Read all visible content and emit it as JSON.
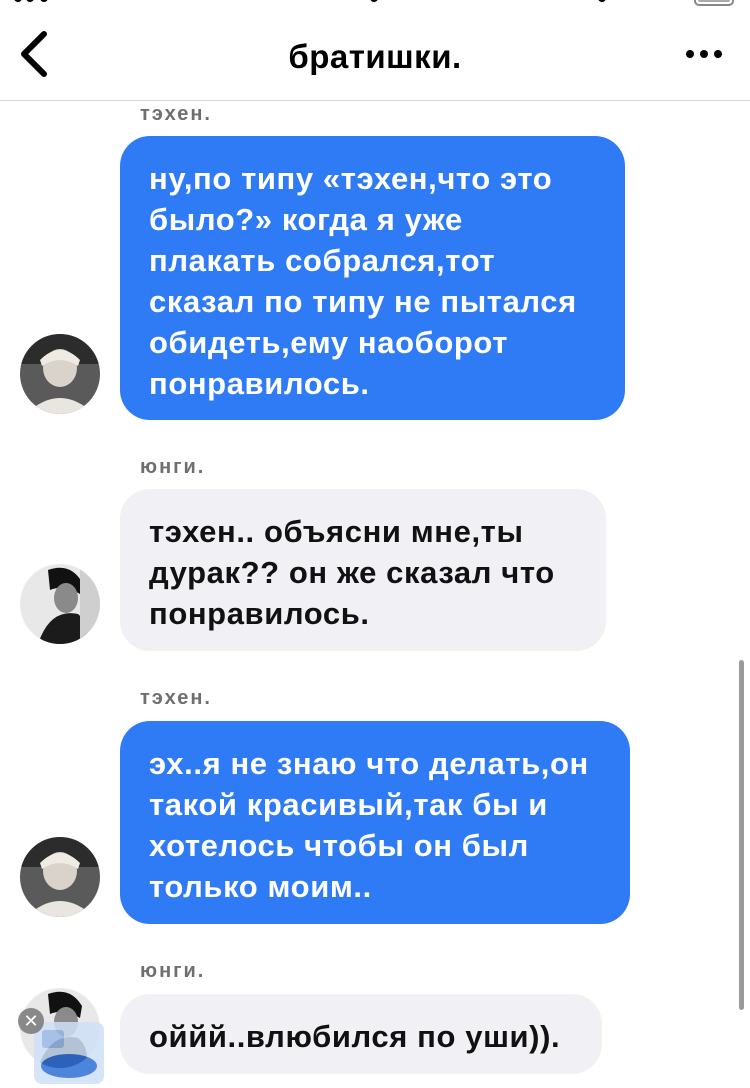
{
  "header": {
    "title": "братишки.",
    "back_icon": "chevron-left-icon",
    "more_icon": "more-dots-icon"
  },
  "messages": [
    {
      "sender": "тэхен.",
      "style": "outgoing-blue",
      "lines": [
        "ну,по типу «тэхен,что это",
        "было?» когда я уже",
        "плакать собрался,тот",
        "сказал по типу не пытался",
        "обидеть,ему наоборот",
        "понравилось."
      ]
    },
    {
      "sender": "юнги.",
      "style": "incoming-gray",
      "lines": [
        "тэхен.. объясни мне,ты",
        "дурак?? он же сказал что",
        "понравилось."
      ]
    },
    {
      "sender": "тэхен.",
      "style": "outgoing-blue",
      "lines": [
        "эх..я не знаю что делать,он",
        "такой красивый,так бы и",
        "хотелось чтобы он был",
        "только моим.."
      ]
    },
    {
      "sender": "юнги.",
      "style": "incoming-gray",
      "lines": [
        "оййй..влюбился по уши))."
      ]
    }
  ],
  "colors": {
    "bubble_blue": "#2f7bf5",
    "bubble_gray": "#f0f0f5",
    "sender_label": "#6f6f6f"
  },
  "overlay": {
    "close_label": "✕",
    "icon": "picture-in-picture-icon"
  }
}
